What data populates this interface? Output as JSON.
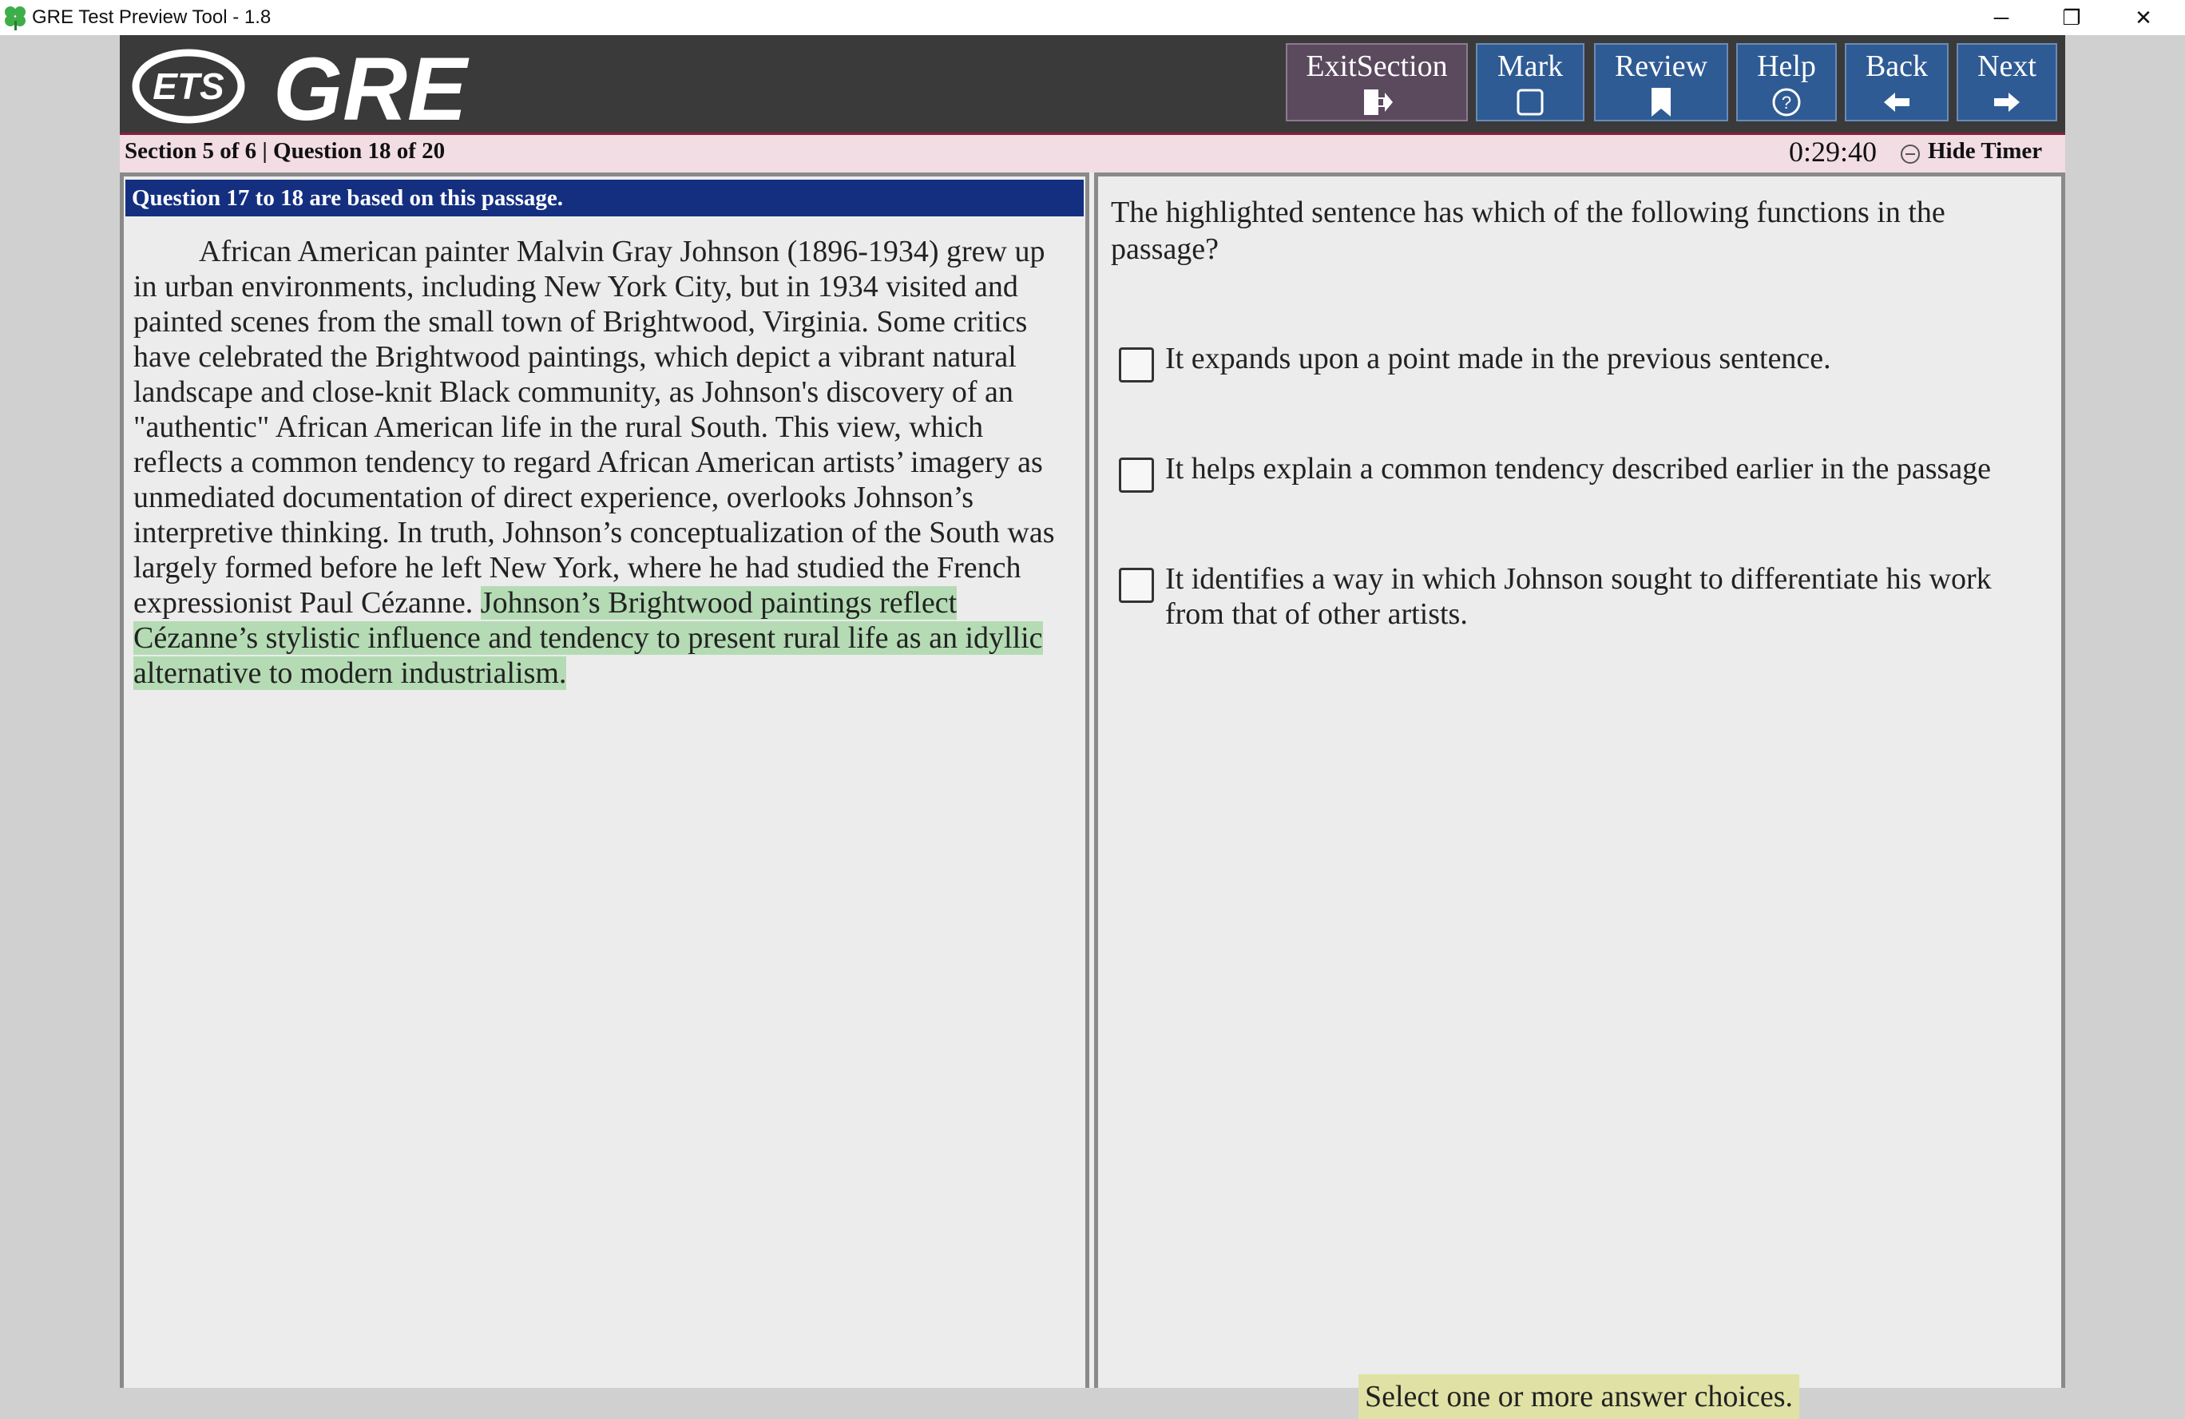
{
  "window": {
    "title": "GRE Test Preview Tool - 1.8",
    "minimize_glyph": "─",
    "restore_glyph": "❐",
    "close_glyph": "✕"
  },
  "header": {
    "logo_ets": "ETS",
    "logo_gre": "GRE",
    "buttons": {
      "exit": "ExitSection",
      "mark": "Mark",
      "review": "Review",
      "help": "Help",
      "back": "Back",
      "next": "Next"
    }
  },
  "status": {
    "section_info": "Section 5 of 6 | Question 18 of 20",
    "timer": "0:29:40",
    "hide_timer": "Hide Timer"
  },
  "passage": {
    "header": "Question 17 to 18 are based on this passage.",
    "text": "African American painter Malvin Gray Johnson (1896-1934) grew up in urban environments, including New York City, but in 1934 visited and painted scenes from the small town of Brightwood, Virginia. Some critics have celebrated the Brightwood paintings, which depict a vibrant natural landscape and close-knit Black community, as Johnson's discovery of an \"authentic\" African American life in the rural South. This view, which reflects a common tendency to regard African American artists’ imagery as unmediated documentation of direct experience, overlooks Johnson’s interpretive thinking. In truth, Johnson’s conceptualization of the South was largely formed before he left New York, where he had studied the French expressionist Paul Cézanne. ",
    "highlighted": "Johnson’s Brightwood paintings reflect Cézanne’s stylistic influence and tendency to present rural life as an idyllic alternative to modern industrialism."
  },
  "question": {
    "prompt": "The highlighted sentence has which of the following functions in the passage?",
    "choices": [
      {
        "text": "It expands upon a point made in the previous sentence.",
        "checked": false
      },
      {
        "text": "It helps explain a common tendency described earlier in the passage",
        "checked": false
      },
      {
        "text": "It identifies a way in which Johnson sought to differentiate his work from that of other artists.",
        "checked": false
      }
    ],
    "instruction": "Select one or more answer choices."
  },
  "colors": {
    "header_bg": "#3a3a3a",
    "nav_button": "#2f5b94",
    "exit_button": "#5b4a5e",
    "status_bg": "#f1dde3",
    "passage_header": "#142f7f",
    "highlight": "#b5dbb5",
    "instruction_bg": "#dfe2a4"
  }
}
